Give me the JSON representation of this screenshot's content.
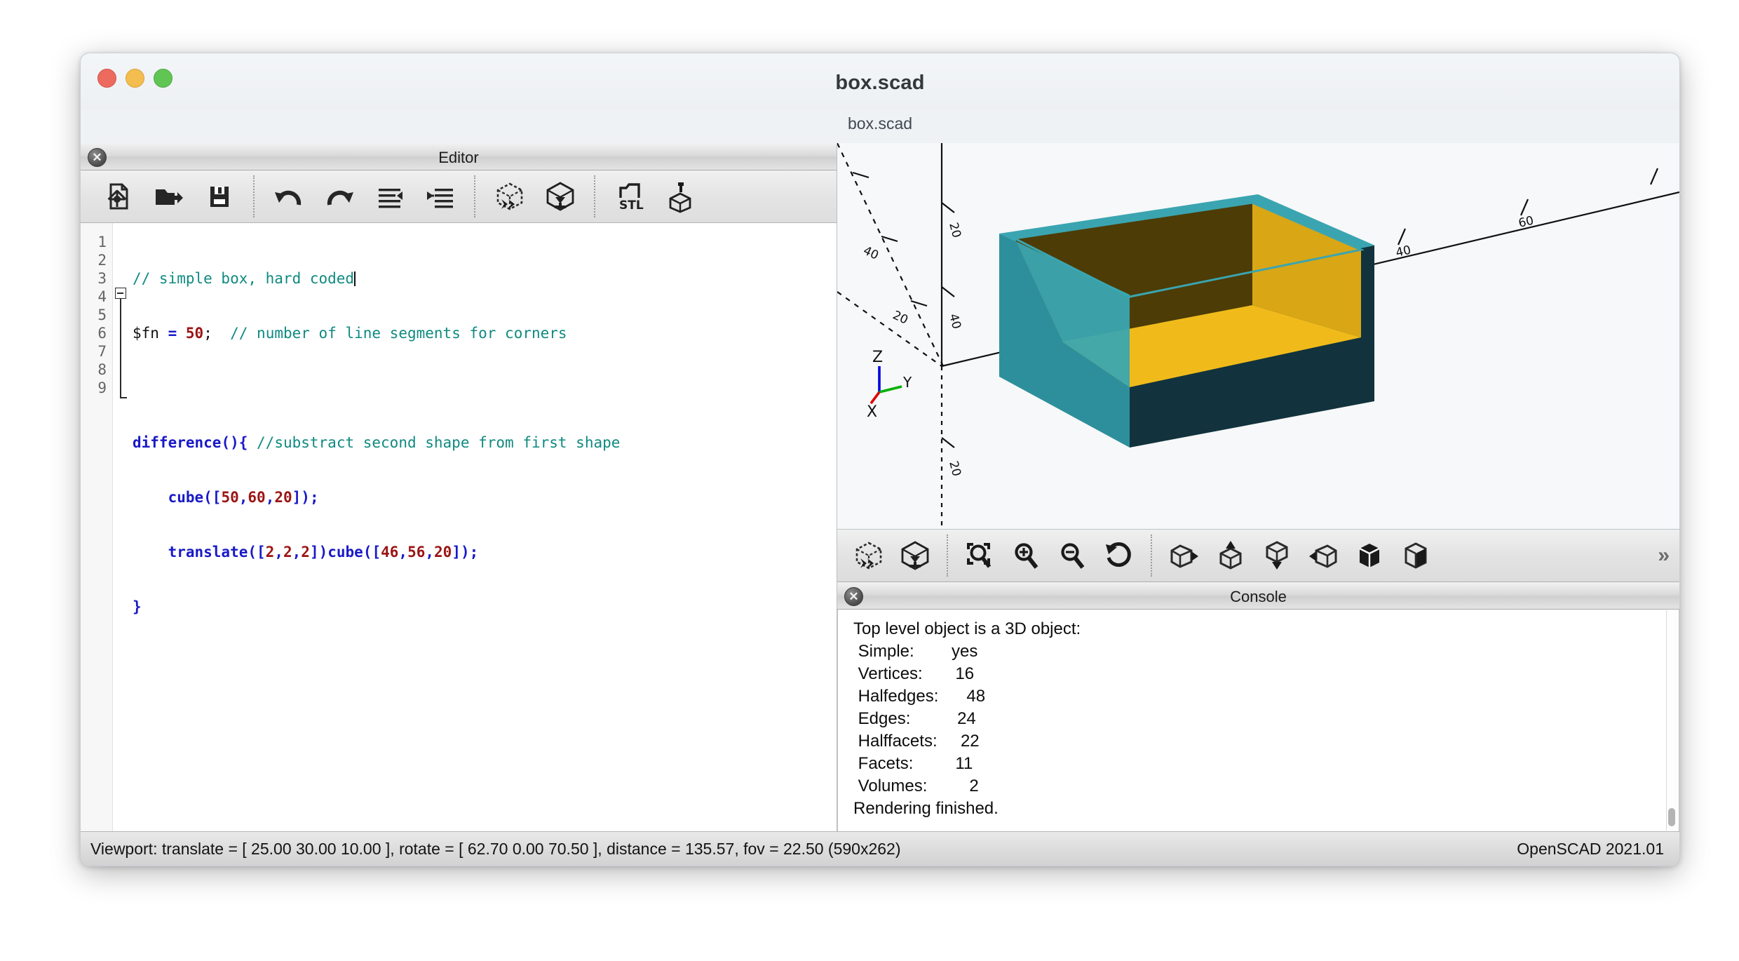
{
  "window": {
    "title": "box.scad",
    "tab_label": "box.scad",
    "traffic": {
      "close": "close-window",
      "minimize": "minimize-window",
      "maximize": "maximize-window",
      "close_color": "#ed6a5e",
      "minimize_color": "#f4bd4f",
      "maximize_color": "#61c554"
    }
  },
  "editor": {
    "dock_title": "Editor",
    "close_glyph": "✕",
    "toolbar": [
      {
        "name": "new-file-button",
        "icon": "new-file-icon",
        "tip": "New"
      },
      {
        "name": "open-file-button",
        "icon": "open-folder-icon",
        "tip": "Open"
      },
      {
        "name": "save-file-button",
        "icon": "save-disk-icon",
        "tip": "Save"
      },
      {
        "name": "undo-button",
        "icon": "undo-arrow-icon",
        "tip": "Undo"
      },
      {
        "name": "redo-button",
        "icon": "redo-arrow-icon",
        "tip": "Redo"
      },
      {
        "name": "unindent-button",
        "icon": "unindent-icon",
        "tip": "Unindent"
      },
      {
        "name": "indent-button",
        "icon": "indent-icon",
        "tip": "Indent"
      },
      {
        "name": "preview-button",
        "icon": "preview-icon",
        "tip": "Preview"
      },
      {
        "name": "render-button",
        "icon": "render-icon",
        "tip": "Render"
      },
      {
        "name": "export-stl-button",
        "icon": "stl-icon",
        "tip": "Export as STL"
      },
      {
        "name": "export-3d-button",
        "icon": "export-3d-icon",
        "tip": "Export"
      }
    ],
    "line_numbers": [
      "1",
      "2",
      "3",
      "4",
      "5",
      "6",
      "7",
      "8",
      "9"
    ],
    "code_lines": [
      {
        "n": 1,
        "text": "// simple box, hard coded"
      },
      {
        "n": 2,
        "text": "$fn = 50;  // number of line segments for corners"
      },
      {
        "n": 3,
        "text": ""
      },
      {
        "n": 4,
        "text": "difference(){ //substract second shape from first shape"
      },
      {
        "n": 5,
        "text": "    cube([50,60,20]);"
      },
      {
        "n": 6,
        "text": "    translate([2,2,2])cube([46,56,20]);"
      },
      {
        "n": 7,
        "text": "}"
      },
      {
        "n": 8,
        "text": ""
      },
      {
        "n": 9,
        "text": ""
      }
    ],
    "colors": {
      "comment": "#0f8a80",
      "keyword": "#1919c8",
      "number": "#9c1414",
      "plain": "#101010"
    }
  },
  "viewport": {
    "axis_labels": {
      "x": "X",
      "y": "Y",
      "z": "Z"
    },
    "axis_colors": {
      "x": "#e00000",
      "y": "#00b000",
      "z": "#0000e0"
    },
    "model_colors": {
      "top_rim": "#3aa5b0",
      "left_face": "#2e8f9c",
      "front_face": "#12333d",
      "inner_floor": "#f0bb1a",
      "inner_right_wall": "#d9a616",
      "inner_shadow": "#4d3c06"
    },
    "tick_labels_x": [
      "20",
      "40",
      "60"
    ],
    "tick_labels_y": [
      "20",
      "40",
      "60"
    ],
    "toolbar": [
      {
        "name": "preview-button",
        "icon": "preview-icon",
        "tip": "Preview"
      },
      {
        "name": "render-button",
        "icon": "render-icon",
        "tip": "Render"
      },
      {
        "name": "zoom-all-button",
        "icon": "zoom-all-icon",
        "tip": "View All"
      },
      {
        "name": "zoom-in-button",
        "icon": "zoom-in-icon",
        "tip": "Zoom In"
      },
      {
        "name": "zoom-out-button",
        "icon": "zoom-out-icon",
        "tip": "Zoom Out"
      },
      {
        "name": "reset-view-button",
        "icon": "reset-view-icon",
        "tip": "Reset View"
      },
      {
        "name": "view-right-button",
        "icon": "view-right-icon",
        "tip": "Right View"
      },
      {
        "name": "view-top-button",
        "icon": "view-top-icon",
        "tip": "Top View"
      },
      {
        "name": "view-bottom-button",
        "icon": "view-bottom-icon",
        "tip": "Bottom View"
      },
      {
        "name": "view-left-button",
        "icon": "view-left-icon",
        "tip": "Left View"
      },
      {
        "name": "view-front-button",
        "icon": "view-front-icon",
        "tip": "Front View"
      },
      {
        "name": "view-back-button",
        "icon": "view-back-icon",
        "tip": "Back View"
      }
    ],
    "overflow_glyph": "»"
  },
  "console": {
    "dock_title": "Console",
    "close_glyph": "✕",
    "lines": [
      "Top level object is a 3D object:",
      " Simple:        yes",
      " Vertices:       16",
      " Halfedges:      48",
      " Edges:          24",
      " Halffacets:     22",
      " Facets:         11",
      " Volumes:         2",
      "Rendering finished."
    ]
  },
  "statusbar": {
    "left": "Viewport: translate = [ 25.00 30.00 10.00 ], rotate = [ 62.70 0.00 70.50 ], distance = 135.57, fov = 22.50 (590x262)",
    "right": "OpenSCAD 2021.01"
  }
}
